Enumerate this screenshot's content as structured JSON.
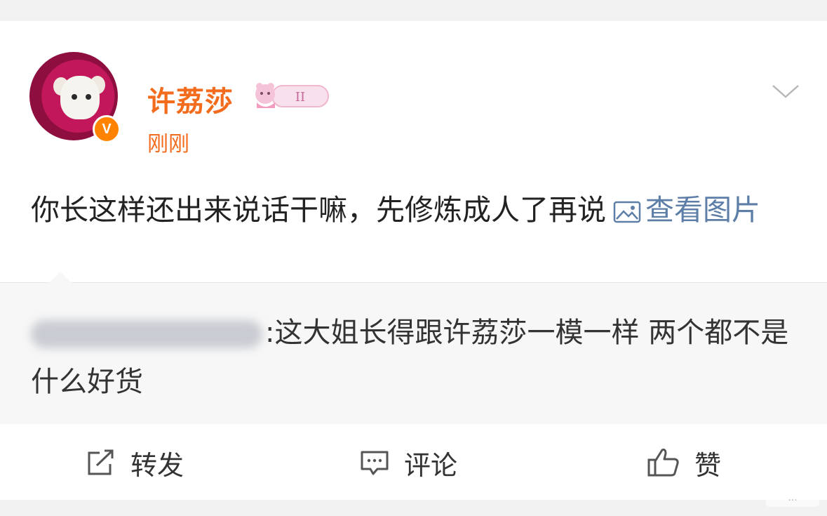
{
  "post": {
    "author": "许荔莎",
    "time": "刚刚",
    "verified_badge": "V",
    "text": "你长这样还出来说话干嘛，先修炼成人了再说",
    "view_image_link": "查看图片"
  },
  "repost": {
    "text": ":这大姐长得跟许荔莎一模一样 两个都不是什么好货"
  },
  "actions": {
    "repost_label": "转发",
    "comment_label": "评论",
    "like_label": "赞"
  },
  "icons": {
    "menu": "chevron-down-icon",
    "image": "image-icon",
    "repost": "share-icon",
    "comment": "comment-icon",
    "like": "thumbs-up-icon"
  },
  "colors": {
    "name_accent": "#f36b1c",
    "link": "#5c7ea7",
    "verified": "#ff8200"
  }
}
